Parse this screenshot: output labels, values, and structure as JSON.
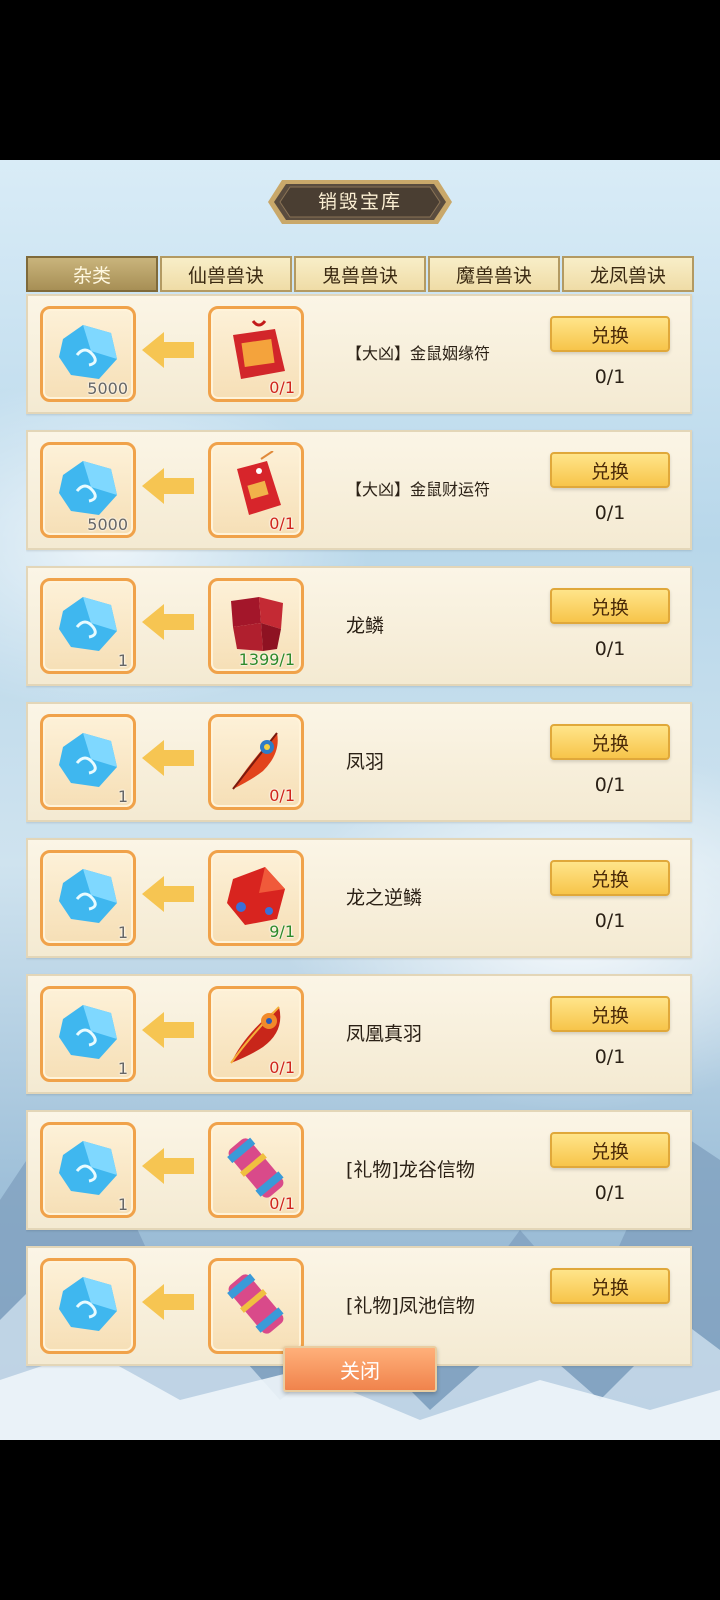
{
  "title": "销毁宝库",
  "tabs": [
    "杂类",
    "仙兽兽诀",
    "鬼兽兽诀",
    "魔兽兽诀",
    "龙凤兽诀"
  ],
  "active_tab": 0,
  "rows": [
    {
      "cost": "5000",
      "item_icon": "red-talisman-pouch-icon",
      "owned": "0/1",
      "owned_ok": false,
      "name": "【大凶】金鼠姻缘符",
      "button": "兑换",
      "progress": "0/1"
    },
    {
      "cost": "5000",
      "item_icon": "red-charm-tag-icon",
      "owned": "0/1",
      "owned_ok": false,
      "name": "【大凶】金鼠财运符",
      "button": "兑换",
      "progress": "0/1"
    },
    {
      "cost": "1",
      "item_icon": "dragon-scale-icon",
      "owned": "1399/1",
      "owned_ok": true,
      "name": "龙鳞",
      "button": "兑换",
      "progress": "0/1"
    },
    {
      "cost": "1",
      "item_icon": "phoenix-feather-icon",
      "owned": "0/1",
      "owned_ok": false,
      "name": "凤羽",
      "button": "兑换",
      "progress": "0/1"
    },
    {
      "cost": "1",
      "item_icon": "reverse-dragon-scale-icon",
      "owned": "9/1",
      "owned_ok": true,
      "name": "龙之逆鳞",
      "button": "兑换",
      "progress": "0/1"
    },
    {
      "cost": "1",
      "item_icon": "phoenix-true-feather-icon",
      "owned": "0/1",
      "owned_ok": false,
      "name": "凤凰真羽",
      "button": "兑换",
      "progress": "0/1"
    },
    {
      "cost": "1",
      "item_icon": "scroll-icon",
      "owned": "0/1",
      "owned_ok": false,
      "name": "[礼物]龙谷信物",
      "button": "兑换",
      "progress": "0/1"
    },
    {
      "cost": "",
      "item_icon": "scroll-icon",
      "owned": "",
      "owned_ok": false,
      "name": "[礼物]凤池信物",
      "button": "兑换",
      "progress": ""
    }
  ],
  "close_button": "关闭",
  "colors": {
    "accent": "#f7c54a",
    "slot_border": "#f0a24a",
    "owned_red": "#d0261c",
    "owned_green": "#2f8a2a"
  }
}
